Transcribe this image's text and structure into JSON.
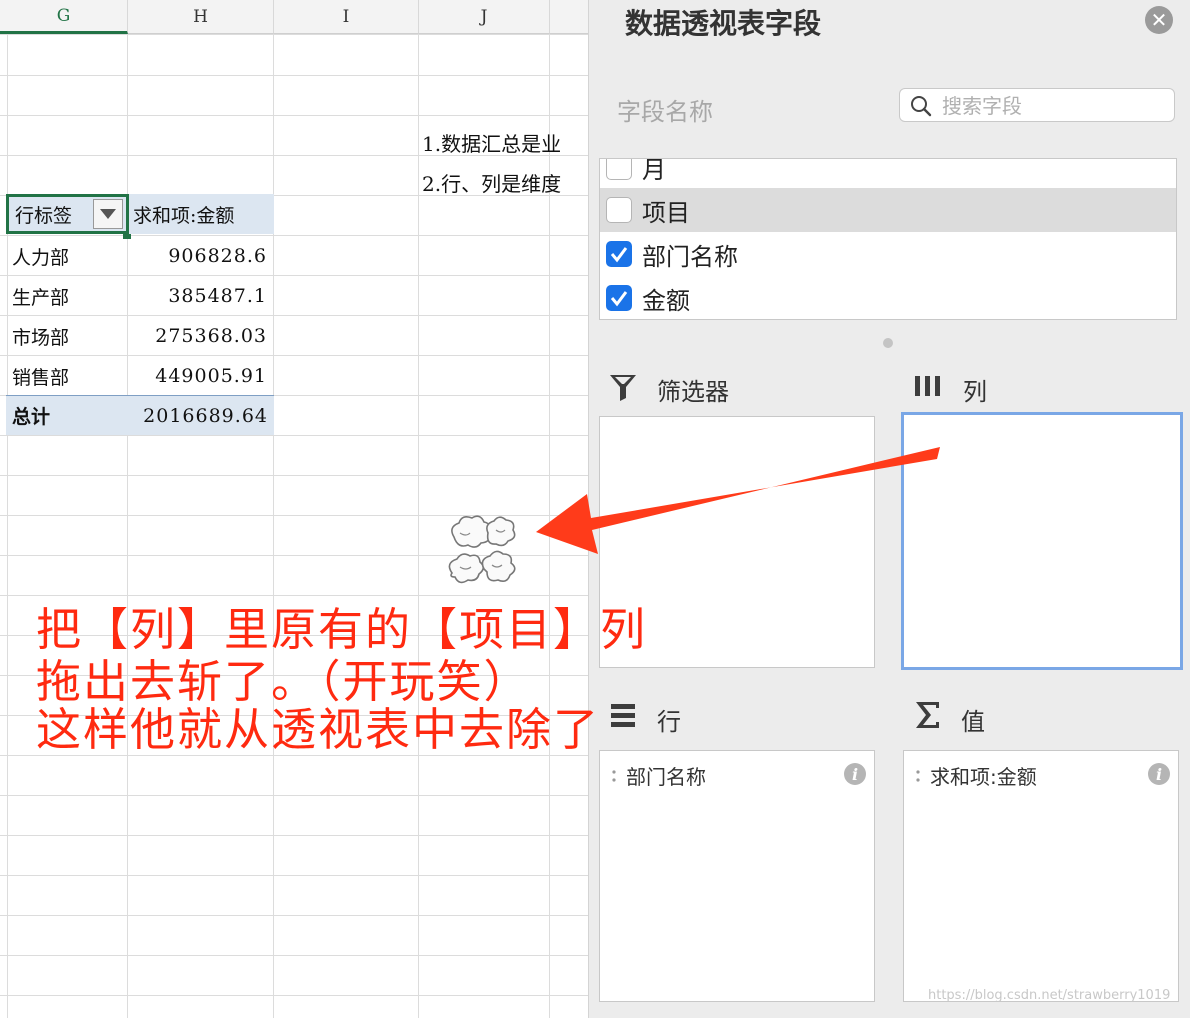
{
  "sheet": {
    "columns": [
      "G",
      "H",
      "I",
      "J"
    ],
    "notes": [
      "1.数据汇总是业",
      "2.行、列是维度"
    ],
    "pivot": {
      "header_label": "行标签",
      "header_value": "求和项:金额",
      "rows": [
        {
          "label": "人力部",
          "value": "906828.6"
        },
        {
          "label": "生产部",
          "value": "385487.1"
        },
        {
          "label": "市场部",
          "value": "275368.03"
        },
        {
          "label": "销售部",
          "value": "449005.91"
        }
      ],
      "total_label": "总计",
      "total_value": "2016689.64"
    }
  },
  "annotation": {
    "lines": [
      "把【列】里原有的【项目】列",
      "拖出去斩了。（开玩笑）",
      "这样他就从透视表中去除了"
    ],
    "color": "#ff2a10"
  },
  "panel": {
    "title": "数据透视表字段",
    "field_name_label": "字段名称",
    "search_placeholder": "搜索字段",
    "fields": [
      {
        "label": "月",
        "checked": false
      },
      {
        "label": "项目",
        "checked": false
      },
      {
        "label": "部门名称",
        "checked": true
      },
      {
        "label": "金额",
        "checked": true
      }
    ],
    "areas": {
      "filters": {
        "title": "筛选器",
        "icon": "funnel-icon"
      },
      "columns": {
        "title": "列",
        "icon": "columns-icon"
      },
      "rows": {
        "title": "行",
        "icon": "rows-icon",
        "item": "部门名称"
      },
      "values": {
        "title": "值",
        "icon": "sigma-icon",
        "item": "求和项:金额"
      }
    },
    "accent_color": "#1a73e8"
  },
  "watermark": "https://blog.csdn.net/strawberry1019"
}
